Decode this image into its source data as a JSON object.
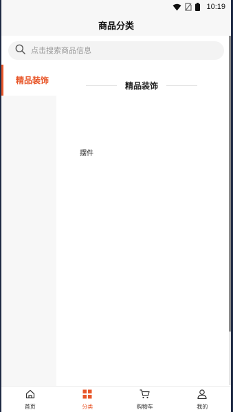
{
  "status_bar": {
    "time": "10:19"
  },
  "header": {
    "title": "商品分类"
  },
  "search": {
    "placeholder": "点击搜索商品信息"
  },
  "sidebar": {
    "items": [
      {
        "label": "精品装饰",
        "active": true
      }
    ]
  },
  "content": {
    "section_title": "精品装饰",
    "items": [
      {
        "label": "摆件"
      }
    ]
  },
  "tab_bar": {
    "tabs": [
      {
        "label": "首页",
        "icon": "home-icon",
        "active": false
      },
      {
        "label": "分类",
        "icon": "category-icon",
        "active": true
      },
      {
        "label": "购物车",
        "icon": "cart-icon",
        "active": false
      },
      {
        "label": "我的",
        "icon": "user-icon",
        "active": false
      }
    ]
  },
  "colors": {
    "accent": "#e8572a",
    "background": "#f7f7f7"
  }
}
